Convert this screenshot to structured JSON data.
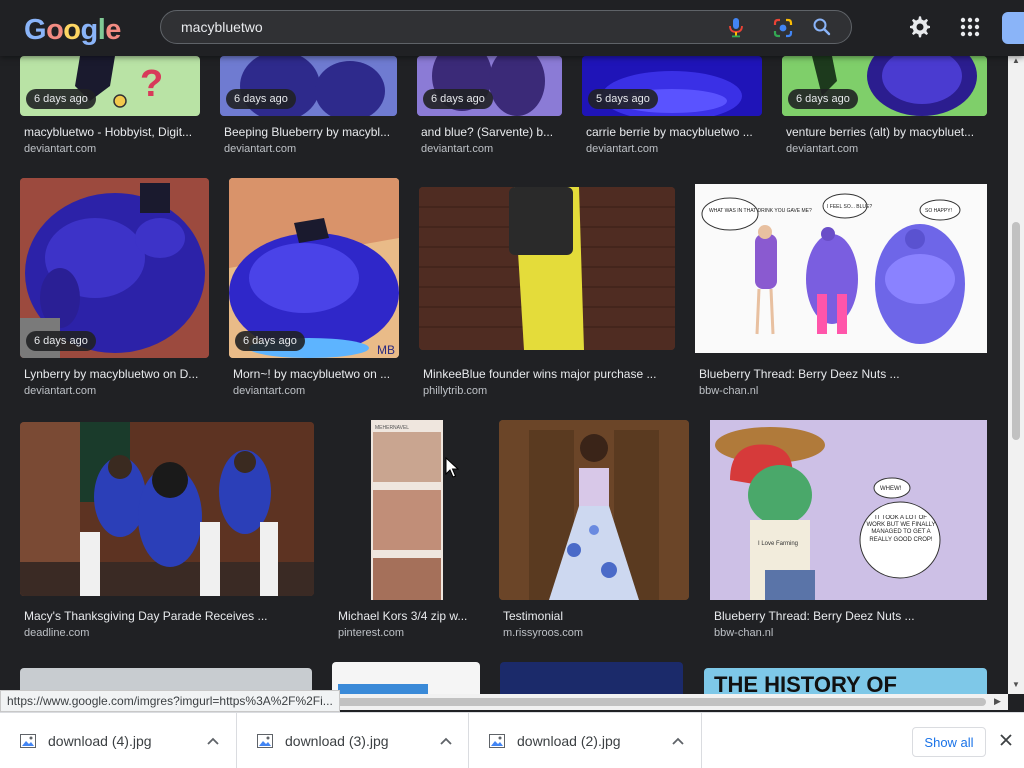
{
  "header": {
    "logo_letters": [
      "G",
      "o",
      "o",
      "g",
      "l",
      "e"
    ],
    "logo_colors": [
      "#8ab4f8",
      "#f28b82",
      "#fdd663",
      "#8ab4f8",
      "#81c995",
      "#f28b82"
    ],
    "query": "macybluetwo"
  },
  "results": [
    {
      "title": "macybluetwo - Hobbyist, Digit...",
      "source": "deviantart.com",
      "age": "6 days ago"
    },
    {
      "title": "Beeping Blueberry by macybl...",
      "source": "deviantart.com",
      "age": "6 days ago"
    },
    {
      "title": "and blue? (Sarvente) b...",
      "source": "deviantart.com",
      "age": "6 days ago"
    },
    {
      "title": "carrie berrie by macybluetwo ...",
      "source": "deviantart.com",
      "age": "5 days ago"
    },
    {
      "title": "venture berries (alt) by macybluet...",
      "source": "deviantart.com",
      "age": "6 days ago"
    },
    {
      "title": "Lynberry by macybluetwo on D...",
      "source": "deviantart.com",
      "age": "6 days ago"
    },
    {
      "title": "Morn~! by macybluetwo on ...",
      "source": "deviantart.com",
      "age": "6 days ago"
    },
    {
      "title": "MinkeeBlue founder wins major purchase ...",
      "source": "phillytrib.com",
      "age": ""
    },
    {
      "title": "Blueberry Thread: Berry Deez Nuts ...",
      "source": "bbw-chan.nl",
      "age": ""
    },
    {
      "title": "Macy's Thanksgiving Day Parade Receives ...",
      "source": "deadline.com",
      "age": ""
    },
    {
      "title": "Michael Kors 3/4 zip w...",
      "source": "pinterest.com",
      "age": ""
    },
    {
      "title": "Testimonial",
      "source": "m.rissyroos.com",
      "age": ""
    },
    {
      "title": "Blueberry Thread: Berry Deez Nuts ...",
      "source": "bbw-chan.nl",
      "age": ""
    }
  ],
  "bottom_row_partial_text": "THE HISTORY OF",
  "comic_bubbles": {
    "bubble_1": "WHAT WAS IN THAT DRINK YOU GAVE ME?",
    "bubble_2": "I FEEL SO... BLUE?",
    "bubble_3": "SO HAPPY!",
    "whew": "WHEW!",
    "finally": "IT TOOK A LOT OF WORK BUT WE FINALLY MANAGED TO GET A REALLY GOOD CROP!",
    "signature": "MB",
    "shirt": "I Love Farming"
  },
  "pin_brand": "MEHERNAVEL",
  "status_url": "https://www.google.com/imgres?imgurl=https%3A%2F%2Fi...",
  "downloads": [
    {
      "name": "download (4).jpg"
    },
    {
      "name": "download (3).jpg"
    },
    {
      "name": "download (2).jpg"
    }
  ],
  "show_all_label": "Show all",
  "colors": {
    "background": "#202124",
    "accent_blue": "#8ab4f8",
    "link_blue": "#1a73e8"
  }
}
